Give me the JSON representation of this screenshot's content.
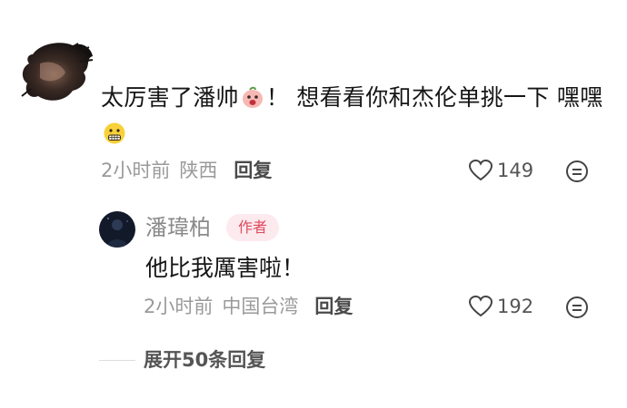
{
  "comment": {
    "text_part1": "太厉害了潘帅",
    "emoji1": "peach-face-emoji",
    "text_part2": "！ 想看看你和杰伦单挑一下 嘿嘿",
    "emoji2": "grimace-face-emoji",
    "time": "2小时前",
    "location": "陕西",
    "reply_label": "回复",
    "likes": "149"
  },
  "reply": {
    "author": "潘瑋柏",
    "badge": "作者",
    "text": "他比我厲害啦！",
    "time": "2小时前",
    "location": "中国台湾",
    "reply_label": "回复",
    "likes": "192"
  },
  "expand": {
    "label": "展开50条回复"
  },
  "colors": {
    "badge_text": "#e04a5f",
    "badge_bg": "#fdeaee",
    "meta_gray": "#9a9a9a"
  }
}
